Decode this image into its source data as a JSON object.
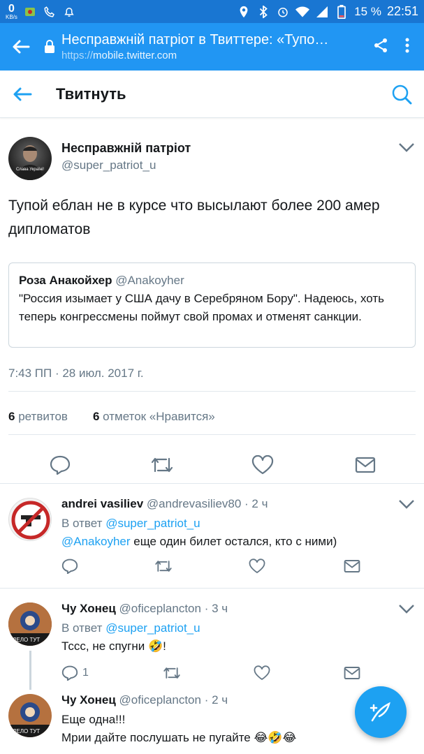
{
  "status_bar": {
    "net_speed": "0",
    "net_unit": "KB/s",
    "battery": "15 %",
    "time": "22:51"
  },
  "browser": {
    "title": "Несправжній патріот в Твиттере: «Тупо…",
    "url_scheme": "https://",
    "url_host": "mobile.twitter.com"
  },
  "header": {
    "title": "Твитнуть"
  },
  "tweet": {
    "author_name": "Несправжній патріот",
    "author_handle": "@super_patriot_u",
    "avatar_caption": "Слава Україні!",
    "text": "Тупой еблан не в курсе что высылают более 200 амер дипломатов",
    "quote": {
      "name": "Роза Анакойхер",
      "handle": "@Anakoyher",
      "text": "\"Россия изымает у США дачу в Серебряном Бору\". Надеюсь, хоть теперь конгрессмены поймут свой промах и отменят санкции."
    },
    "timestamp": "7:43 ПП · 28 июл. 2017 г.",
    "retweets_count": "6",
    "retweets_label": "ретвитов",
    "likes_count": "6",
    "likes_label": "отметок «Нравится»"
  },
  "replies": [
    {
      "name": "andrei vasiliev",
      "handle": "@andrevasiliev80",
      "time": "· 2 ч",
      "reply_prefix": "В ответ",
      "reply_to": "@super_patriot_u",
      "mention": "@Anakoyher",
      "text": " еще один билет остался, кто с ними)",
      "reply_count": ""
    },
    {
      "name": "Чу Хонец",
      "handle": "@oficeplancton",
      "time": "· 3 ч",
      "reply_prefix": "В ответ",
      "reply_to": "@super_patriot_u",
      "text": "Тссс, не спугни 🤣!",
      "reply_count": "1"
    },
    {
      "name": "Чу Хонец",
      "handle": "@oficeplancton",
      "time": "· 2 ч",
      "line1": "Еще одна!!!",
      "line2": "Мрии дайте послушать не пугайте 😂🤣😂"
    }
  ],
  "colors": {
    "status_bar": "#1976d2",
    "toolbar": "#2196f3",
    "twitter_blue": "#1da1f2",
    "muted": "#657786"
  }
}
